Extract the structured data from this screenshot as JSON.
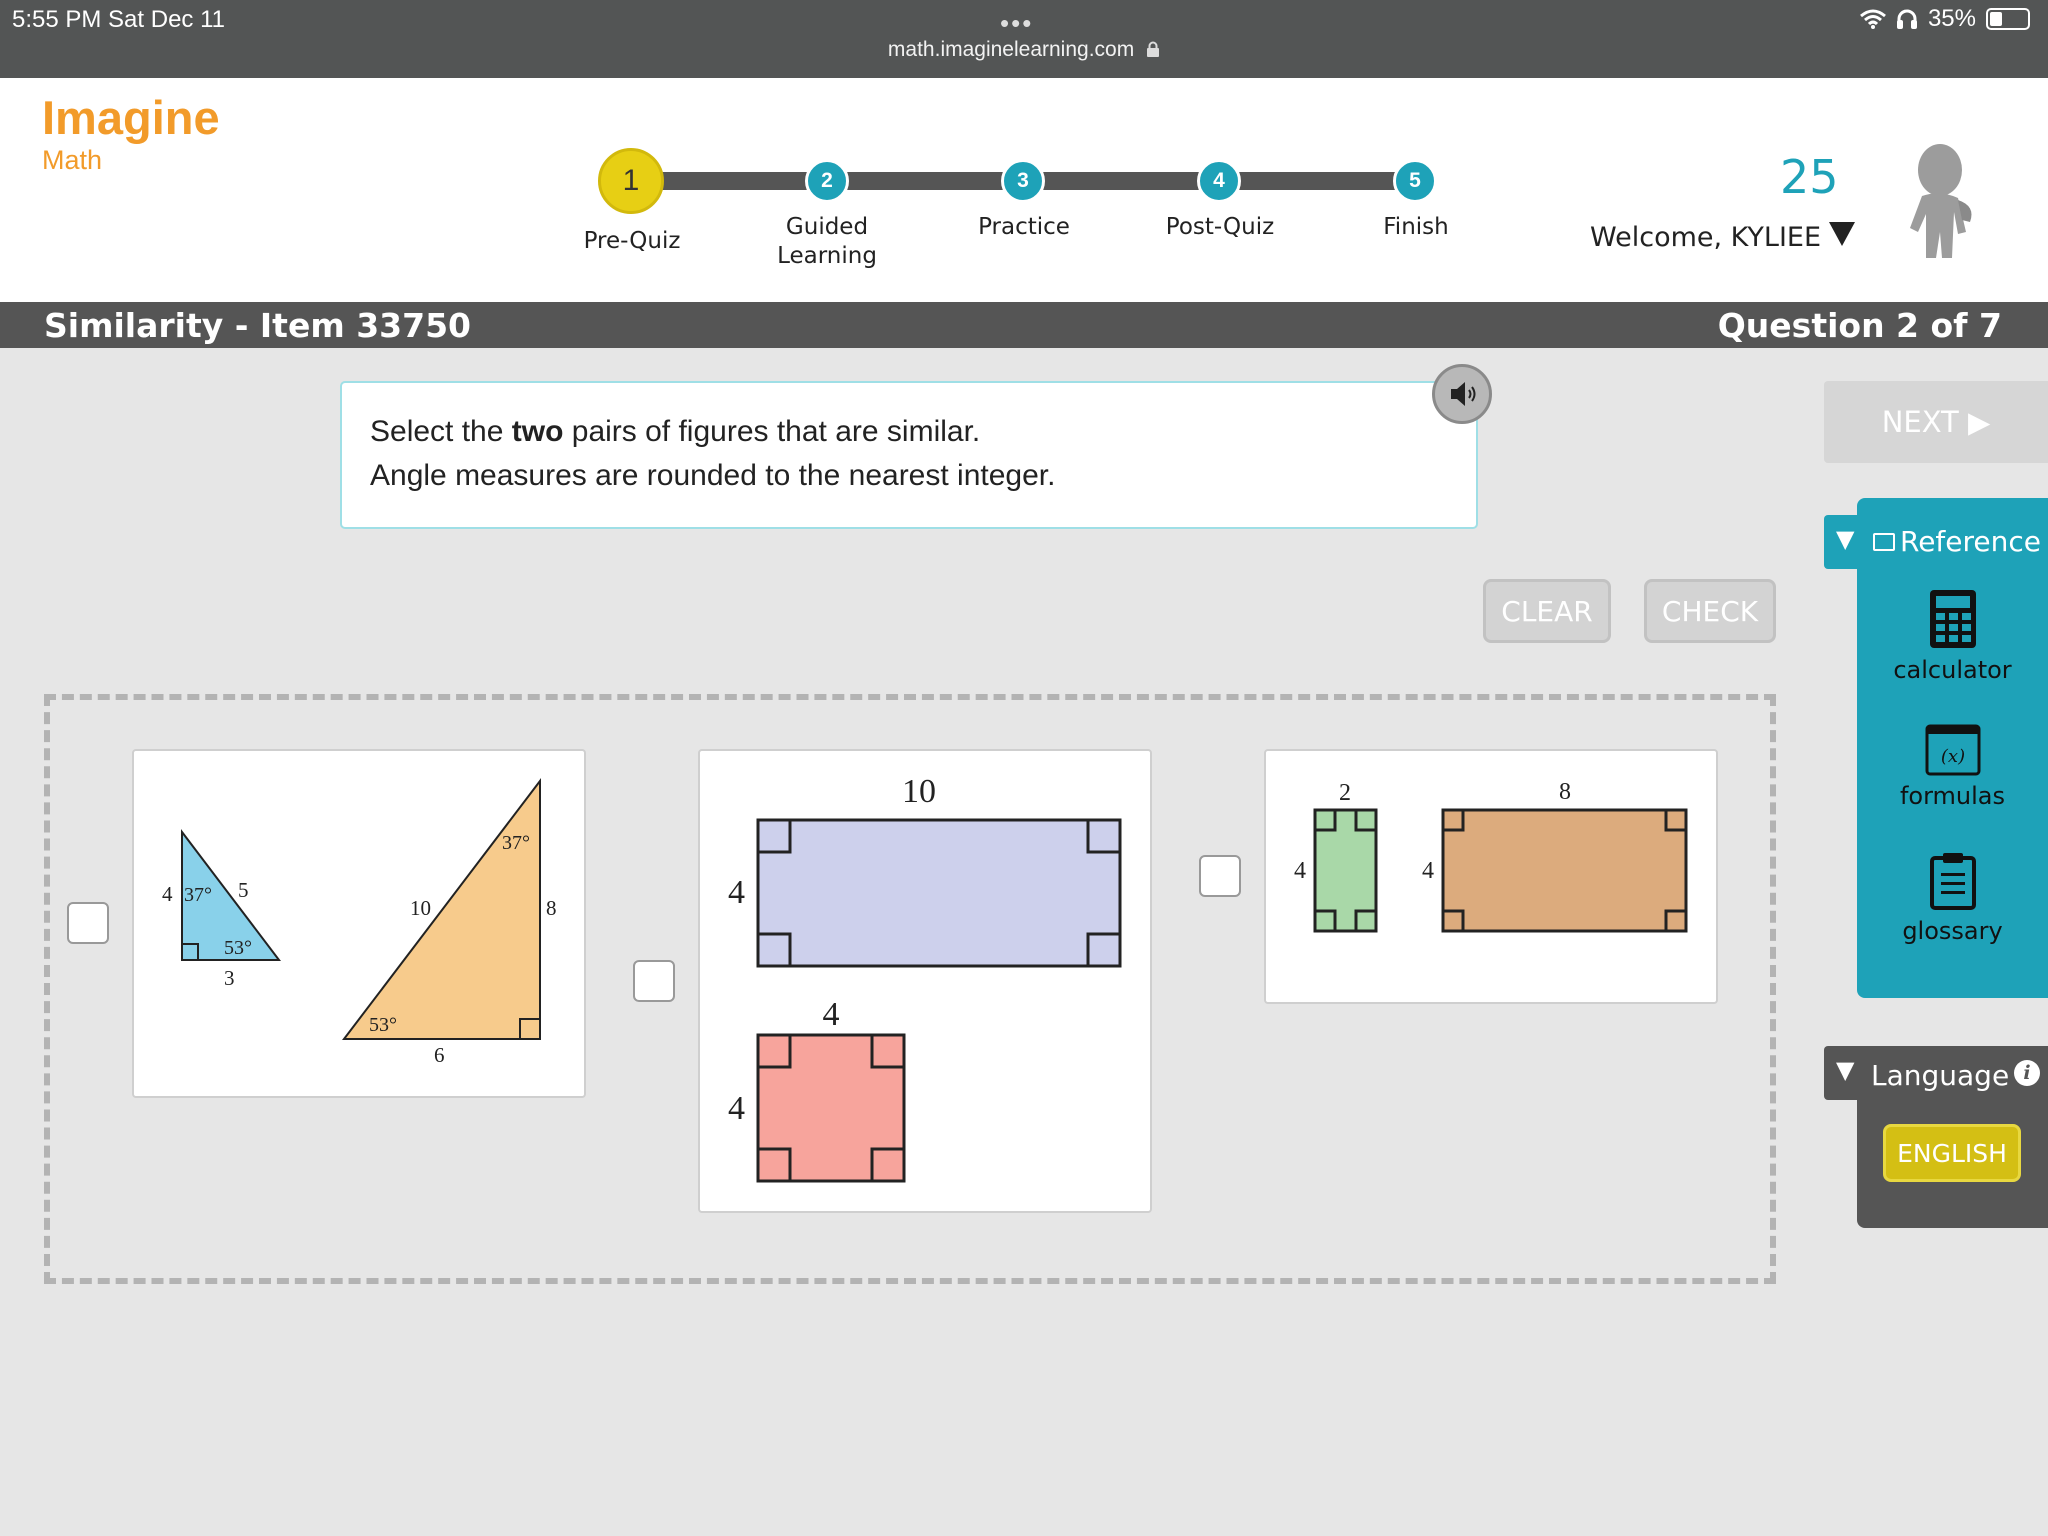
{
  "status_bar": {
    "time": "5:55 PM   Sat Dec 11",
    "dots": "•••",
    "url": "math.imaginelearning.com",
    "battery": "35%"
  },
  "header": {
    "logo_line1": "Imagine",
    "logo_line2": "Math",
    "steps": [
      {
        "number": "1",
        "label": "Pre-Quiz",
        "current": true
      },
      {
        "number": "2",
        "label": "Guided Learning",
        "current": false
      },
      {
        "number": "3",
        "label": "Practice",
        "current": false
      },
      {
        "number": "4",
        "label": "Post-Quiz",
        "current": false
      },
      {
        "number": "5",
        "label": "Finish",
        "current": false
      }
    ],
    "score": "25",
    "welcome": "Welcome, KYLIEE"
  },
  "title_bar": {
    "lesson": "Similarity - Item 33750",
    "question": "Question 2 of 7"
  },
  "prompt": {
    "line1_before": "Select the ",
    "line1_bold": "two",
    "line1_after": " pairs of figures that are similar.",
    "line2": "Angle measures are rounded to the nearest integer."
  },
  "buttons": {
    "next": "NEXT ▶",
    "clear": "CLEAR",
    "check": "CHECK",
    "english": "ENGLISH"
  },
  "reference": {
    "label": "Reference",
    "tools": [
      "calculator",
      "formulas",
      "glossary"
    ]
  },
  "language": {
    "label": "Language",
    "info": "i"
  },
  "figures": {
    "pair1": {
      "small_triangle": {
        "side_left": "4",
        "side_hyp": "5",
        "side_bottom": "3",
        "angle_top": "37°",
        "angle_bottom": "53°"
      },
      "large_triangle": {
        "side_hyp": "10",
        "side_right": "8",
        "side_bottom": "6",
        "angle_top": "37°",
        "angle_bottom": "53°"
      }
    },
    "pair2": {
      "rectangle": {
        "width": "10",
        "height": "4"
      },
      "square": {
        "width": "4",
        "height": "4"
      }
    },
    "pair3": {
      "small_rectangle": {
        "width": "2",
        "height": "4"
      },
      "large_rectangle": {
        "width": "8",
        "height": "4"
      }
    }
  },
  "colors": {
    "accent_teal": "#1ea2b8",
    "logo_orange": "#f29b2a",
    "current_step_yellow": "#e7cf14",
    "english_button": "#d4bf14",
    "fill_blue_triangle": "#89d1ea",
    "fill_orange_triangle": "#f7cb8c",
    "fill_lavender": "#cdd0ec",
    "fill_pink": "#f7a49c",
    "fill_green": "#a9d8a8",
    "fill_tan": "#dcab7d"
  }
}
